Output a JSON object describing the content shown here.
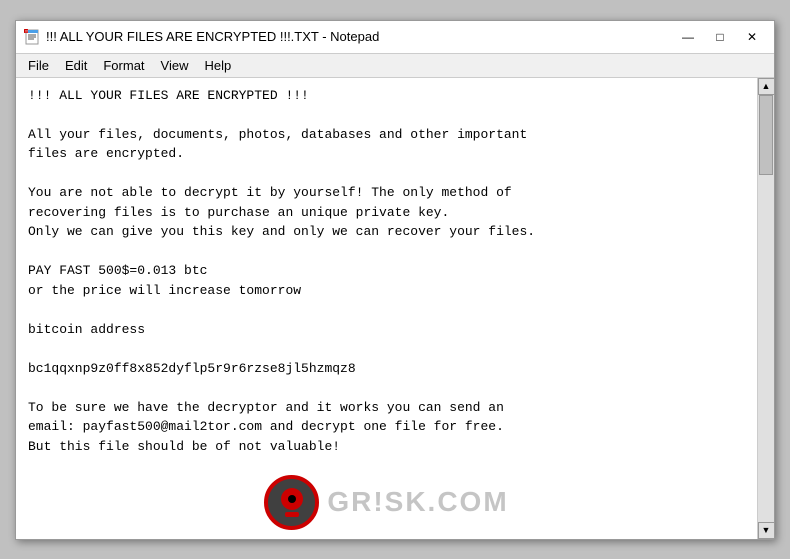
{
  "window": {
    "title": "!!! ALL YOUR FILES ARE ENCRYPTED !!!.TXT - Notepad",
    "icon": "notepad"
  },
  "menu": {
    "items": [
      "File",
      "Edit",
      "Format",
      "View",
      "Help"
    ]
  },
  "titlebar": {
    "minimize_label": "—",
    "maximize_label": "□",
    "close_label": "✕"
  },
  "content": {
    "text": "!!! ALL YOUR FILES ARE ENCRYPTED !!!\n\nAll your files, documents, photos, databases and other important\nfiles are encrypted.\n\nYou are not able to decrypt it by yourself! The only method of\nrecovering files is to purchase an unique private key.\nOnly we can give you this key and only we can recover your files.\n\nPAY FAST 500$=0.013 btc\nor the price will increase tomorrow\n\nbitcoin address\n\nbc1qqxnp9z0ff8x852dyflp5r9r6rzse8jl5hzmqz8\n\nTo be sure we have the decryptor and it works you can send an\nemail: payfast500@mail2tor.com and decrypt one file for free.\nBut this file should be of not valuable!"
  },
  "watermark": {
    "text": "GR!SK.COM"
  }
}
